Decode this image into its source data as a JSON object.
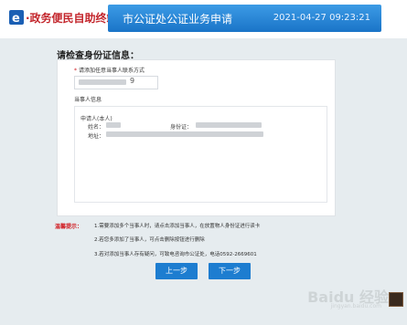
{
  "header": {
    "logo_mark": "e",
    "logo_text": "·政务便民自助终端",
    "title": "市公证处公证业务申请",
    "datetime": "2021-04-27 09:23:21"
  },
  "section": {
    "title": "请检查身份证信息："
  },
  "contact": {
    "required_mark": "*",
    "label": "请添加任意当事人联系方式",
    "value_visible_suffix": "9"
  },
  "party": {
    "section_title": "当事人信息",
    "person_title": "申请人(本人)",
    "name_label": "姓名：",
    "id_label": "身份证：",
    "address_label": "地址："
  },
  "tips": {
    "label": "温馨提示：",
    "lines": [
      "1.需要添加多个当事人时，请点击添加当事人，在放置物人身份证进行读卡",
      "2.若您多添加了当事人，可点击删除按钮进行删除",
      "3.若对添加当事人存有疑问，可致电咨询市公证处，电话0592-2669601"
    ]
  },
  "buttons": {
    "prev_label": "上一步",
    "next_label": "下一步"
  },
  "watermark": {
    "text": "Baidu 经验",
    "sub": "jingyan.baidu.com"
  },
  "colors": {
    "header_blue": "#1a74c8",
    "button_blue": "#1d7dd0",
    "logo_red": "#c3262c",
    "tip_red": "#d0181e"
  }
}
